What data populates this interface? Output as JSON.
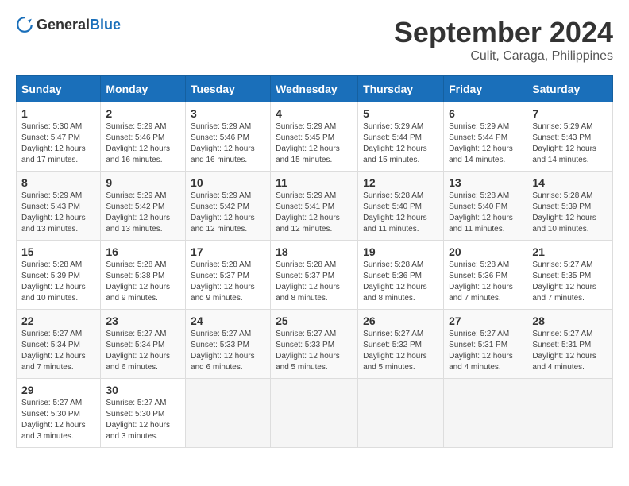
{
  "header": {
    "logo_general": "General",
    "logo_blue": "Blue",
    "month_title": "September 2024",
    "location": "Culit, Caraga, Philippines"
  },
  "columns": [
    "Sunday",
    "Monday",
    "Tuesday",
    "Wednesday",
    "Thursday",
    "Friday",
    "Saturday"
  ],
  "weeks": [
    [
      {
        "day": "1",
        "sunrise": "5:30 AM",
        "sunset": "5:47 PM",
        "daylight": "12 hours and 17 minutes."
      },
      {
        "day": "2",
        "sunrise": "5:29 AM",
        "sunset": "5:46 PM",
        "daylight": "12 hours and 16 minutes."
      },
      {
        "day": "3",
        "sunrise": "5:29 AM",
        "sunset": "5:46 PM",
        "daylight": "12 hours and 16 minutes."
      },
      {
        "day": "4",
        "sunrise": "5:29 AM",
        "sunset": "5:45 PM",
        "daylight": "12 hours and 15 minutes."
      },
      {
        "day": "5",
        "sunrise": "5:29 AM",
        "sunset": "5:44 PM",
        "daylight": "12 hours and 15 minutes."
      },
      {
        "day": "6",
        "sunrise": "5:29 AM",
        "sunset": "5:44 PM",
        "daylight": "12 hours and 14 minutes."
      },
      {
        "day": "7",
        "sunrise": "5:29 AM",
        "sunset": "5:43 PM",
        "daylight": "12 hours and 14 minutes."
      }
    ],
    [
      {
        "day": "8",
        "sunrise": "5:29 AM",
        "sunset": "5:43 PM",
        "daylight": "12 hours and 13 minutes."
      },
      {
        "day": "9",
        "sunrise": "5:29 AM",
        "sunset": "5:42 PM",
        "daylight": "12 hours and 13 minutes."
      },
      {
        "day": "10",
        "sunrise": "5:29 AM",
        "sunset": "5:42 PM",
        "daylight": "12 hours and 12 minutes."
      },
      {
        "day": "11",
        "sunrise": "5:29 AM",
        "sunset": "5:41 PM",
        "daylight": "12 hours and 12 minutes."
      },
      {
        "day": "12",
        "sunrise": "5:28 AM",
        "sunset": "5:40 PM",
        "daylight": "12 hours and 11 minutes."
      },
      {
        "day": "13",
        "sunrise": "5:28 AM",
        "sunset": "5:40 PM",
        "daylight": "12 hours and 11 minutes."
      },
      {
        "day": "14",
        "sunrise": "5:28 AM",
        "sunset": "5:39 PM",
        "daylight": "12 hours and 10 minutes."
      }
    ],
    [
      {
        "day": "15",
        "sunrise": "5:28 AM",
        "sunset": "5:39 PM",
        "daylight": "12 hours and 10 minutes."
      },
      {
        "day": "16",
        "sunrise": "5:28 AM",
        "sunset": "5:38 PM",
        "daylight": "12 hours and 9 minutes."
      },
      {
        "day": "17",
        "sunrise": "5:28 AM",
        "sunset": "5:37 PM",
        "daylight": "12 hours and 9 minutes."
      },
      {
        "day": "18",
        "sunrise": "5:28 AM",
        "sunset": "5:37 PM",
        "daylight": "12 hours and 8 minutes."
      },
      {
        "day": "19",
        "sunrise": "5:28 AM",
        "sunset": "5:36 PM",
        "daylight": "12 hours and 8 minutes."
      },
      {
        "day": "20",
        "sunrise": "5:28 AM",
        "sunset": "5:36 PM",
        "daylight": "12 hours and 7 minutes."
      },
      {
        "day": "21",
        "sunrise": "5:27 AM",
        "sunset": "5:35 PM",
        "daylight": "12 hours and 7 minutes."
      }
    ],
    [
      {
        "day": "22",
        "sunrise": "5:27 AM",
        "sunset": "5:34 PM",
        "daylight": "12 hours and 7 minutes."
      },
      {
        "day": "23",
        "sunrise": "5:27 AM",
        "sunset": "5:34 PM",
        "daylight": "12 hours and 6 minutes."
      },
      {
        "day": "24",
        "sunrise": "5:27 AM",
        "sunset": "5:33 PM",
        "daylight": "12 hours and 6 minutes."
      },
      {
        "day": "25",
        "sunrise": "5:27 AM",
        "sunset": "5:33 PM",
        "daylight": "12 hours and 5 minutes."
      },
      {
        "day": "26",
        "sunrise": "5:27 AM",
        "sunset": "5:32 PM",
        "daylight": "12 hours and 5 minutes."
      },
      {
        "day": "27",
        "sunrise": "5:27 AM",
        "sunset": "5:31 PM",
        "daylight": "12 hours and 4 minutes."
      },
      {
        "day": "28",
        "sunrise": "5:27 AM",
        "sunset": "5:31 PM",
        "daylight": "12 hours and 4 minutes."
      }
    ],
    [
      {
        "day": "29",
        "sunrise": "5:27 AM",
        "sunset": "5:30 PM",
        "daylight": "12 hours and 3 minutes."
      },
      {
        "day": "30",
        "sunrise": "5:27 AM",
        "sunset": "5:30 PM",
        "daylight": "12 hours and 3 minutes."
      },
      null,
      null,
      null,
      null,
      null
    ]
  ]
}
